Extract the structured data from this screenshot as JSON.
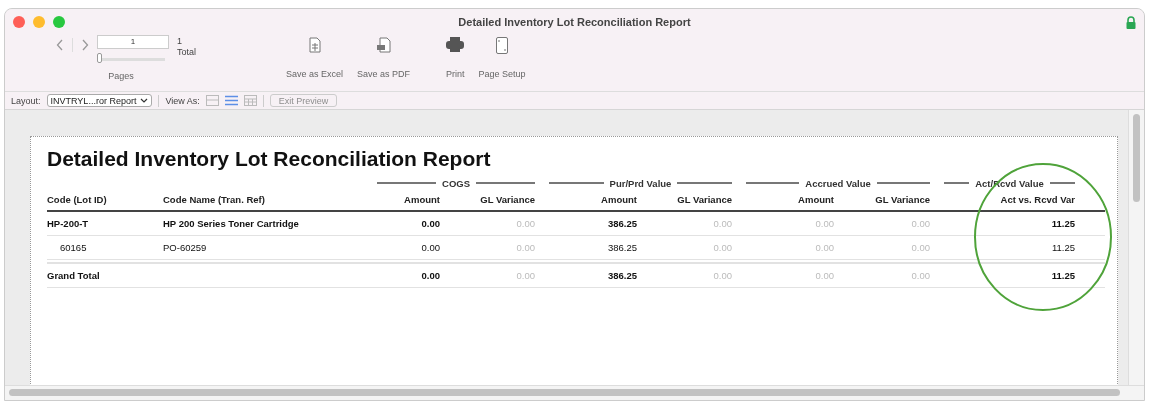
{
  "window": {
    "title": "Detailed Inventory Lot Reconciliation Report"
  },
  "toolbar": {
    "page_field": "1",
    "page_count": "1",
    "total_label": "Total",
    "pages_label": "Pages",
    "slider": {
      "level": 0.0
    },
    "actions": [
      {
        "kind": "excel",
        "label": "Save as Excel"
      },
      {
        "kind": "pdf",
        "label": "Save as PDF"
      },
      {
        "kind": "print",
        "label": "Print"
      },
      {
        "kind": "setup",
        "label": "Page Setup"
      }
    ]
  },
  "layout_bar": {
    "layout_label": "Layout:",
    "layout_value": "INVTRYL...ror Report",
    "view_as_label": "View As:",
    "view_as": [
      {
        "kind": "form",
        "selected": false
      },
      {
        "kind": "list",
        "selected": true
      },
      {
        "kind": "table",
        "selected": false
      }
    ],
    "exit_preview": {
      "label": "Exit Preview",
      "disabled": true
    }
  },
  "report": {
    "title": "Detailed Inventory Lot Reconciliation Report",
    "groups": [
      {
        "label": "COGS"
      },
      {
        "label": "Pur/Prd Value"
      },
      {
        "label": "Accrued Value"
      },
      {
        "label": "Act/Rcvd Value"
      }
    ],
    "columns": [
      {
        "label": "Code (Lot ID)",
        "dimmed": false
      },
      {
        "label": "Code Name (Tran. Ref)",
        "dimmed": false
      },
      {
        "label": "Amount",
        "dimmed": false
      },
      {
        "label": "GL Variance",
        "dimmed": true
      },
      {
        "label": "Amount",
        "dimmed": false
      },
      {
        "label": "GL Variance",
        "dimmed": true
      },
      {
        "label": "Amount",
        "dimmed": true
      },
      {
        "label": "GL Variance",
        "dimmed": true
      },
      {
        "label": "Act vs. Rcvd Var",
        "dimmed": false
      }
    ],
    "rows": [
      {
        "kind": "item",
        "cells": [
          "HP-200-T",
          "HP 200 Series Toner Cartridge",
          "0.00",
          "0.00",
          "386.25",
          "0.00",
          "0.00",
          "0.00",
          "11.25"
        ]
      },
      {
        "kind": "lot",
        "cells": [
          "60165",
          "PO-60259",
          "0.00",
          "0.00",
          "386.25",
          "0.00",
          "0.00",
          "0.00",
          "11.25"
        ]
      },
      {
        "kind": "total",
        "cells": [
          "Grand Total",
          "",
          "0.00",
          "0.00",
          "386.25",
          "0.00",
          "0.00",
          "0.00",
          "11.25"
        ]
      }
    ]
  }
}
